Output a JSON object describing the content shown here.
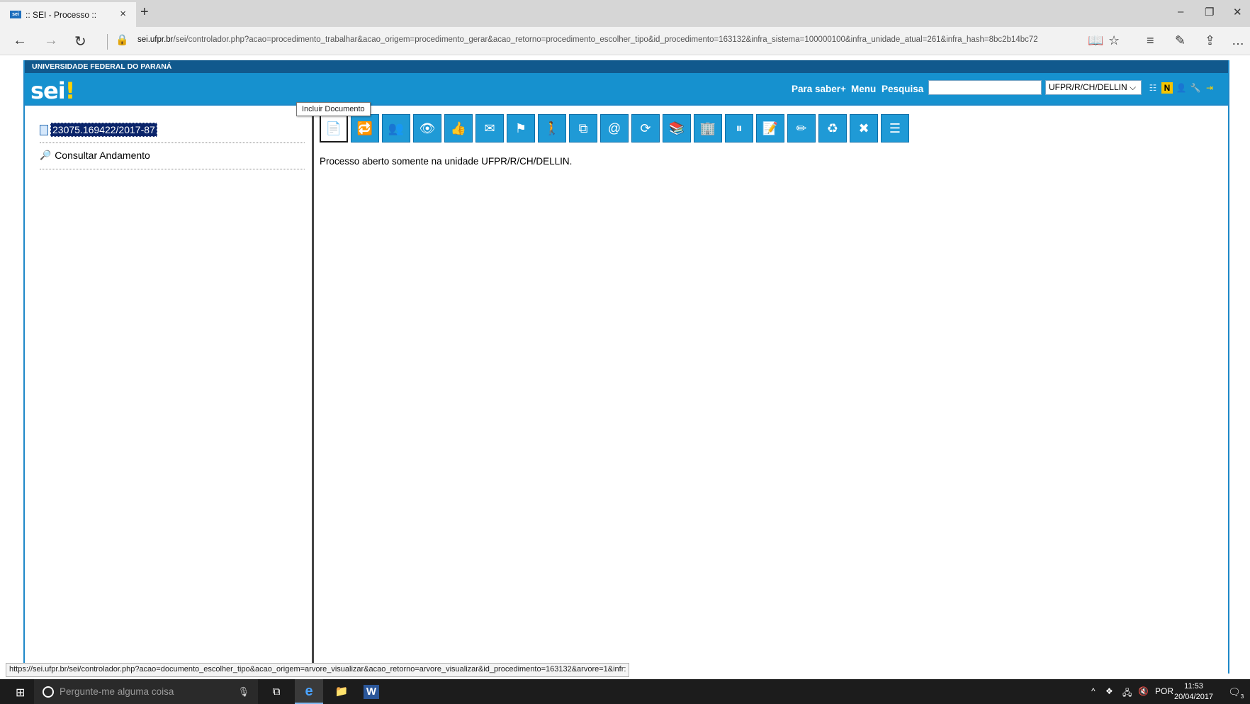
{
  "browser": {
    "tab_title": ":: SEI - Processo ::",
    "tab_favicon_text": "sei",
    "new_tab": "+",
    "tab_close": "×",
    "minimize": "–",
    "restore": "❐",
    "close": "✕",
    "url_host": "sei.ufpr.br",
    "url_path": "/sei/controlador.php?acao=procedimento_trabalhar&acao_origem=procedimento_gerar&acao_retorno=procedimento_escolher_tipo&id_procedimento=163132&infra_sistema=100000100&infra_unidade_atual=261&infra_hash=8bc2b14bc72",
    "back_icon": "←",
    "forward_icon": "→",
    "refresh_icon": "↻",
    "lock_icon": "🔒",
    "reading_view_icon": "📖",
    "favorite_icon": "☆",
    "hub_icon": "≡",
    "notes_icon": "✎",
    "share_icon": "⇪",
    "more_icon": "…"
  },
  "sei": {
    "university": "UNIVERSIDADE FEDERAL DO PARANÁ",
    "logo_text": "sei",
    "logo_bang": "!",
    "para_saber": "Para saber+",
    "menu": "Menu",
    "pesquisa": "Pesquisa",
    "search_value": "",
    "unit_selected": "UFPR/R/CH/DELLIN",
    "unit_caret": "⌵"
  },
  "tree": {
    "process_number": "23075.169422/2017-87",
    "consultar": "Consultar Andamento"
  },
  "toolbar": {
    "tooltip": "Incluir Documento",
    "buttons": [
      {
        "name": "incluir-documento-button",
        "glyph": "📄"
      },
      {
        "name": "iniciar-processo-relacionado-button",
        "glyph": "🔁"
      },
      {
        "name": "atribuir-processo-button",
        "glyph": "👥"
      },
      {
        "name": "acompanhamento-especial-button",
        "glyph": "👁"
      },
      {
        "name": "ciencia-button",
        "glyph": "👍"
      },
      {
        "name": "enviar-processo-button",
        "glyph": "✉"
      },
      {
        "name": "atualizar-andamento-button",
        "glyph": "⚑"
      },
      {
        "name": "gerenciar-credencial-button",
        "glyph": "🚶"
      },
      {
        "name": "duplicar-processo-button",
        "glyph": "⧉"
      },
      {
        "name": "enviar-email-button",
        "glyph": "@"
      },
      {
        "name": "relacionar-processo-button",
        "glyph": "⟳"
      },
      {
        "name": "anexar-processo-button",
        "glyph": "📚"
      },
      {
        "name": "controle-prazos-button",
        "glyph": "🏢"
      },
      {
        "name": "sobrestar-processo-button",
        "glyph": "⏸"
      },
      {
        "name": "anotacoes-button",
        "glyph": "📝"
      },
      {
        "name": "gerenciar-marcador-button",
        "glyph": "✏"
      },
      {
        "name": "excluir-processo-button",
        "glyph": "♻"
      },
      {
        "name": "concluir-processo-button",
        "glyph": "✖"
      },
      {
        "name": "pesquisar-no-processo-button",
        "glyph": "☰"
      }
    ]
  },
  "content": {
    "message": "Processo aberto somente na unidade UFPR/R/CH/DELLIN."
  },
  "status_url": "https://sei.ufpr.br/sei/controlador.php?acao=documento_escolher_tipo&acao_origem=arvore_visualizar&acao_retorno=arvore_visualizar&id_procedimento=163132&arvore=1&infr:",
  "taskbar": {
    "start_icon": "⊞",
    "search_placeholder": "Pergunte-me alguma coisa",
    "mic": "🎙",
    "task_view": "⧉",
    "edge": "e",
    "explorer": "📁",
    "word": "W",
    "tray_chevron": "^",
    "language": "POR",
    "time": "11:53",
    "date": "20/04/2017",
    "notifications_badge": "3"
  }
}
